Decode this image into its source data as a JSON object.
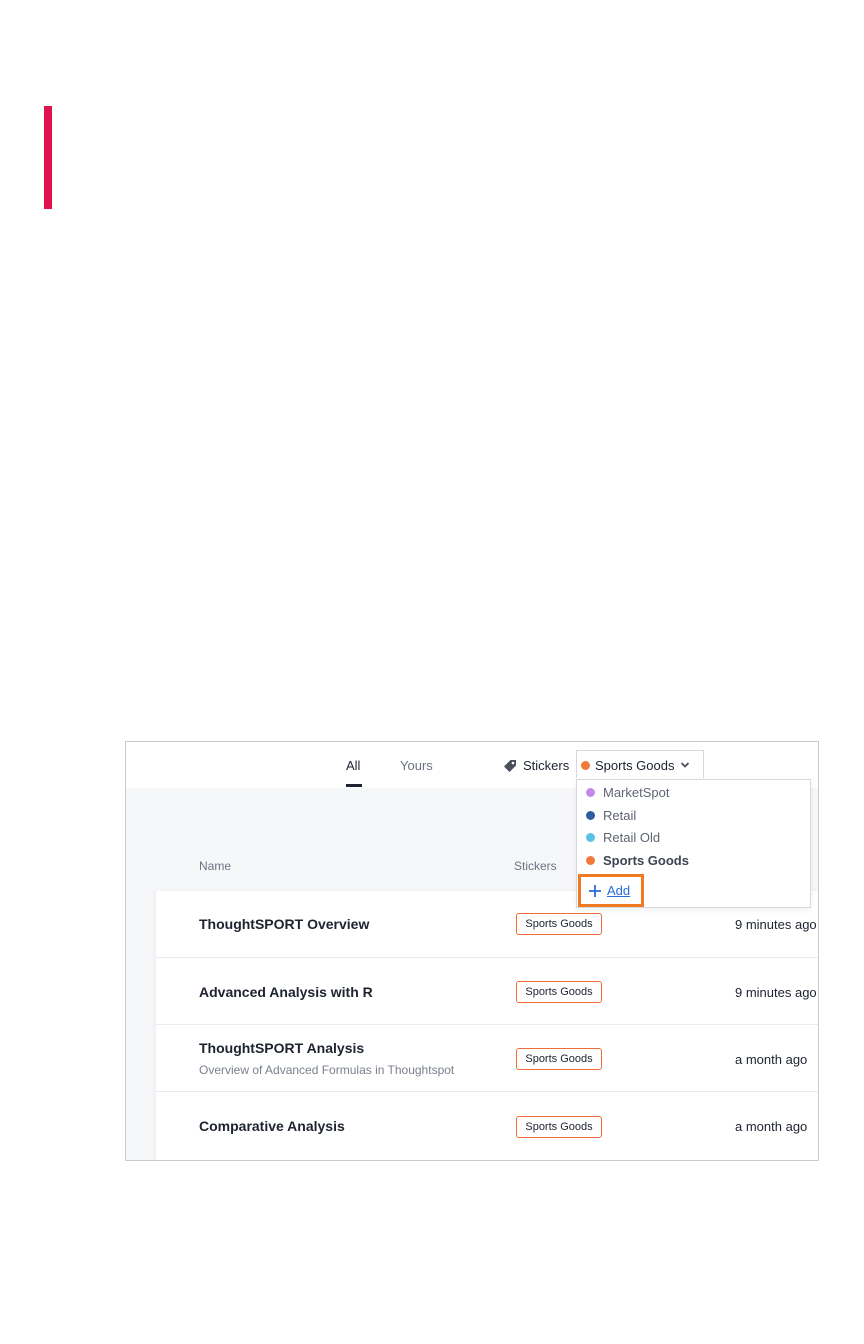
{
  "tabs": [
    {
      "label": "All",
      "active": true
    },
    {
      "label": "Yours",
      "active": false
    }
  ],
  "stickers_filter": {
    "label": "Stickers",
    "icon": "tag-icon",
    "selected": {
      "label": "Sports Goods",
      "color": "#f07a3a"
    }
  },
  "dropdown": {
    "options": [
      {
        "label": "MarketSpot",
        "color": "#c08be8"
      },
      {
        "label": "Retail",
        "color": "#2f5e9e"
      },
      {
        "label": "Retail Old",
        "color": "#5bc2e7"
      },
      {
        "label": "Sports Goods",
        "color": "#f07a3a",
        "selected": true
      }
    ],
    "add_label": "Add",
    "add_icon": "plus-icon"
  },
  "columns": {
    "name": "Name",
    "stickers": "Stickers"
  },
  "rows": [
    {
      "title": "ThoughtSPORT Overview",
      "subtitle": "",
      "sticker": "Sports Goods",
      "time": "9 minutes ago"
    },
    {
      "title": "Advanced Analysis with R",
      "subtitle": "",
      "sticker": "Sports Goods",
      "time": "9 minutes ago"
    },
    {
      "title": "ThoughtSPORT Analysis",
      "subtitle": "Overview of Advanced Formulas in Thoughtspot",
      "sticker": "Sports Goods",
      "time": "a month ago"
    },
    {
      "title": "Comparative Analysis",
      "subtitle": "",
      "sticker": "Sports Goods",
      "time": "a month ago"
    }
  ],
  "colors": {
    "accent_bar": "#e0134f",
    "highlight_box": "#f07a22",
    "sticker_border": "#f26c3b",
    "link": "#2a6bd8"
  }
}
